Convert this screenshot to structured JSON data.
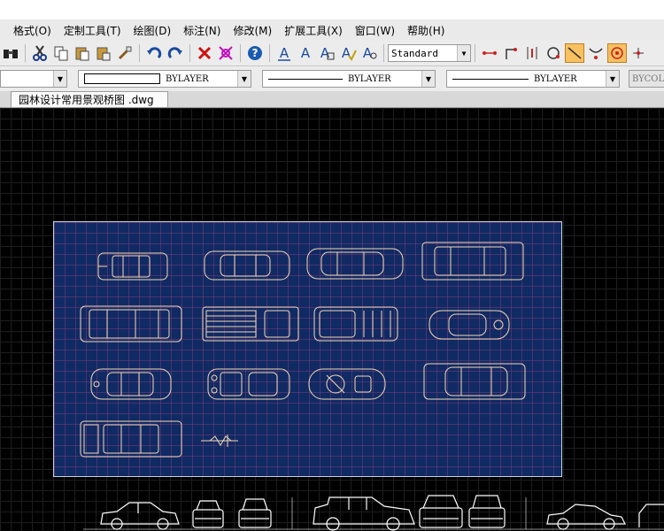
{
  "menu": [
    "格式(O)",
    "定制工具(T)",
    "绘图(D)",
    "标注(N)",
    "修改(M)",
    "扩展工具(X)",
    "窗口(W)",
    "帮助(H)"
  ],
  "toolbar": {
    "text_style": "Standard",
    "icons": [
      "binoculars-icon",
      "cut-icon",
      "copy-icon",
      "paste-icon",
      "paste-special-icon",
      "match-properties-icon",
      "undo-icon",
      "redo-icon",
      "delete-icon",
      "erase-icon",
      "help-icon",
      "text-icon",
      "text-edit-icon",
      "text-find-icon",
      "text-spell-icon",
      "text-scale-icon"
    ]
  },
  "layers": {
    "color": "BYLAYER",
    "linetype": "BYLAYER",
    "lineweight": "BYLAYER",
    "plotstyle": "BYCOLOR"
  },
  "document_tab": "园林设计常用景观桥图 .dwg",
  "colors": {
    "panel_bg": "#102a64",
    "car_stroke": "#f5d9b5",
    "canvas_bg": "#000000",
    "side_cars": "#ffffff"
  }
}
